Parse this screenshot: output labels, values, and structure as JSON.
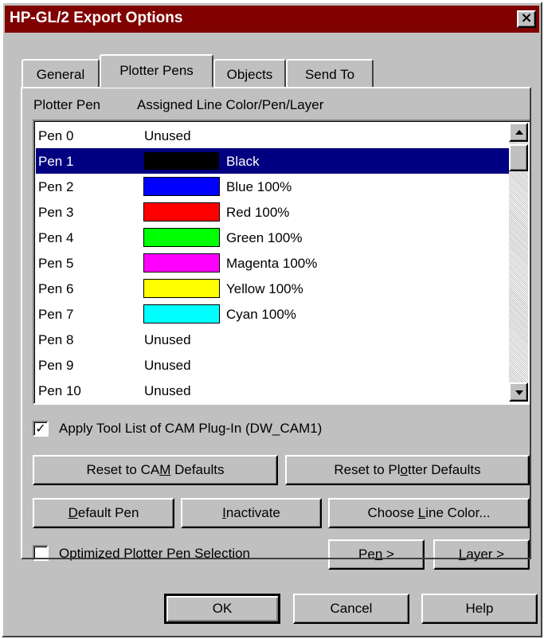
{
  "window": {
    "title": "HP-GL/2 Export Options",
    "close_glyph": "×"
  },
  "tabs": [
    {
      "label": "General",
      "active": false
    },
    {
      "label": "Plotter Pens",
      "active": true
    },
    {
      "label": "Objects",
      "active": false
    },
    {
      "label": "Send To",
      "active": false
    }
  ],
  "table": {
    "columns": [
      "Plotter Pen",
      "Assigned Line Color/Pen/Layer"
    ],
    "rows": [
      {
        "pen": "Pen 0",
        "assignment": "Unused",
        "color": null
      },
      {
        "pen": "Pen 1",
        "assignment": "Black",
        "color": "#000000",
        "selected": true
      },
      {
        "pen": "Pen 2",
        "assignment": "Blue 100%",
        "color": "#0000ff"
      },
      {
        "pen": "Pen 3",
        "assignment": "Red 100%",
        "color": "#ff0000"
      },
      {
        "pen": "Pen 4",
        "assignment": "Green 100%",
        "color": "#00ff00"
      },
      {
        "pen": "Pen 5",
        "assignment": "Magenta 100%",
        "color": "#ff00ff"
      },
      {
        "pen": "Pen 6",
        "assignment": "Yellow 100%",
        "color": "#ffff00"
      },
      {
        "pen": "Pen 7",
        "assignment": "Cyan 100%",
        "color": "#00ffff"
      },
      {
        "pen": "Pen 8",
        "assignment": "Unused",
        "color": null
      },
      {
        "pen": "Pen 9",
        "assignment": "Unused",
        "color": null
      },
      {
        "pen": "Pen 10",
        "assignment": "Unused",
        "color": null
      }
    ]
  },
  "options": {
    "apply_tool_list": {
      "label": "Apply Tool List of CAM Plug-In (DW_CAM1)",
      "checked": true,
      "mark": "✓"
    },
    "optimized_selection": {
      "label": "Optimized Plotter Pen Selection",
      "checked": false,
      "mark": ""
    }
  },
  "buttons": {
    "reset_cam": {
      "pre": "Reset to CA",
      "key": "M",
      "post": " Defaults"
    },
    "reset_plotter": {
      "pre": "Reset to Pl",
      "key": "o",
      "post": "tter Defaults"
    },
    "default_pen": {
      "pre": "",
      "key": "D",
      "post": "efault Pen"
    },
    "inactivate": {
      "pre": "",
      "key": "I",
      "post": "nactivate"
    },
    "choose_line_color": {
      "pre": "Choose ",
      "key": "L",
      "post": "ine Color..."
    },
    "pen_nav": {
      "pre": "Pe",
      "key": "n",
      "post": " >"
    },
    "layer_nav": {
      "pre": "",
      "key": "L",
      "post": "ayer >"
    },
    "ok": "OK",
    "cancel": "Cancel",
    "help": "Help"
  },
  "colors": {
    "titlebar": "#800000",
    "selection": "#000080",
    "face": "#c0c0c0"
  }
}
